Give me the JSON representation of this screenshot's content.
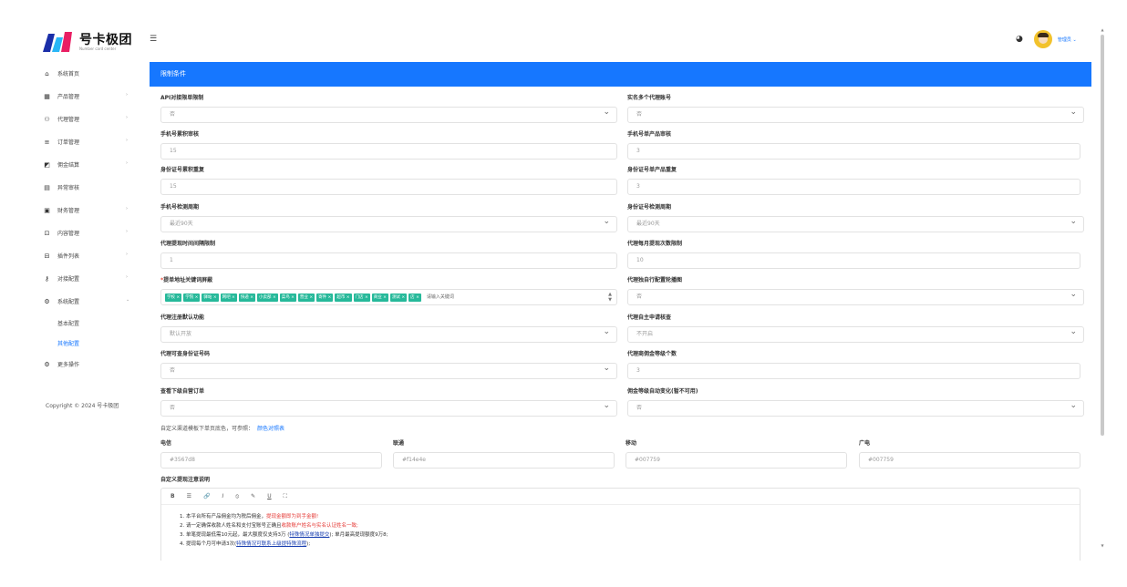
{
  "brand": {
    "title": "号卡极团",
    "subtitle": "Number card center",
    "colors": {
      "primary": "#1677ff",
      "tag": "#26b99a",
      "danger": "#e53935"
    }
  },
  "sidebar": {
    "items": [
      {
        "label": "系统首页",
        "icon": "home-icon"
      },
      {
        "label": "产品管理",
        "icon": "grid-icon"
      },
      {
        "label": "代理管理",
        "icon": "users-icon"
      },
      {
        "label": "订单管理",
        "icon": "list-icon"
      },
      {
        "label": "佣金结算",
        "icon": "wallet-icon"
      },
      {
        "label": "异常审核",
        "icon": "audit-icon"
      },
      {
        "label": "财务管理",
        "icon": "finance-icon"
      },
      {
        "label": "内容管理",
        "icon": "content-icon"
      },
      {
        "label": "插件列表",
        "icon": "plugin-icon"
      },
      {
        "label": "对接配置",
        "icon": "key-icon"
      },
      {
        "label": "系统配置",
        "icon": "settings-icon"
      }
    ],
    "sub_items": [
      {
        "label": "基本配置"
      },
      {
        "label": "其他配置"
      }
    ],
    "more": {
      "label": "更多操作",
      "icon": "more-icon"
    },
    "copyright": "Copyright © 2024 号卡极团"
  },
  "header": {
    "menu_icon": "hamburger-icon",
    "theme_icon": "palette-icon",
    "user_name": "管理员"
  },
  "panel": {
    "title": "限制条件"
  },
  "form": {
    "api_limit": {
      "label": "API对接限单限制",
      "value": "否"
    },
    "multi_account": {
      "label": "实名多个代理账号",
      "value": "否"
    },
    "phone_total": {
      "label": "手机号累积审核",
      "value": "15"
    },
    "phone_single": {
      "label": "手机号单产品审核",
      "value": "3"
    },
    "idcard_total": {
      "label": "身份证号累积重复",
      "value": "15"
    },
    "idcard_single": {
      "label": "身份证号单产品重复",
      "value": "3"
    },
    "phone_period": {
      "label": "手机号检测周期",
      "value": "最近90天"
    },
    "idcard_period": {
      "label": "身份证号检测周期",
      "value": "最近90天"
    },
    "agent_interval": {
      "label": "代理提现时间间隔限制",
      "value": "1"
    },
    "agent_monthly": {
      "label": "代理每月提现次数限制",
      "value": "10"
    },
    "address_keywords": {
      "required_mark": "*",
      "label": "提单地址关键词屏蔽",
      "tags": [
        "学校",
        "学院",
        "驿站",
        "网吧",
        "快递",
        "小卖部",
        "菜鸟",
        "营业",
        "寄件",
        "超市",
        "门店",
        "商业",
        "测试",
        "店"
      ],
      "input_placeholder": "请输入关键词"
    },
    "agent_custom_carousel": {
      "label": "代理独自行配置轮播图",
      "value": "否"
    },
    "agent_register": {
      "label": "代理注册默认功能",
      "value": "默认开放"
    },
    "agent_self_apply": {
      "label": "代理自主申请核查",
      "value": "不开启"
    },
    "agent_idcard_check": {
      "label": "代理可查身份证号码",
      "value": "否"
    },
    "agent_commission_levels": {
      "label": "代理商佣金等级个数",
      "value": "3"
    },
    "order_check": {
      "label": "查看下级自营订单",
      "value": "否"
    },
    "commission_auto": {
      "label": "佣金等级自动变化(暂不可用)",
      "value": "否"
    }
  },
  "note": {
    "text": "自定义渠道模板下单页底色，可参照：",
    "link": "颜色对照表"
  },
  "carriers": {
    "telecom": {
      "label": "电信",
      "value": "#3567d8"
    },
    "unicom": {
      "label": "联通",
      "value": "#f14e4e"
    },
    "mobile": {
      "label": "移动",
      "value": "#007759"
    },
    "broadnet": {
      "label": "广电",
      "value": "#007759"
    }
  },
  "editor": {
    "label": "自定义提现注意说明",
    "toolbar": [
      "B",
      "☰",
      "🔗",
      "I",
      "⦸",
      "✎",
      "U",
      "⛶"
    ],
    "line1_pre": "1. 本平台所有产品佣金均为税后佣金，",
    "line1_red": "提现金额即为到手金额!",
    "line2_pre": "2. 请一定确保收款人姓名和支付宝账号正确且",
    "line2_red": "收款账户姓名与实名认证姓名一致;",
    "line3_pre": "3. 单笔提现最低需10元起，最大额度仅支持3万 (",
    "line3_link": "特殊情况单独提交",
    "line3_post": "); 单月最高提现额度9万8;",
    "line4_pre": "4. 提现每个月可申请3次(",
    "line4_link": "特殊情况可联系上级提特殊流程",
    "line4_post": ");"
  }
}
